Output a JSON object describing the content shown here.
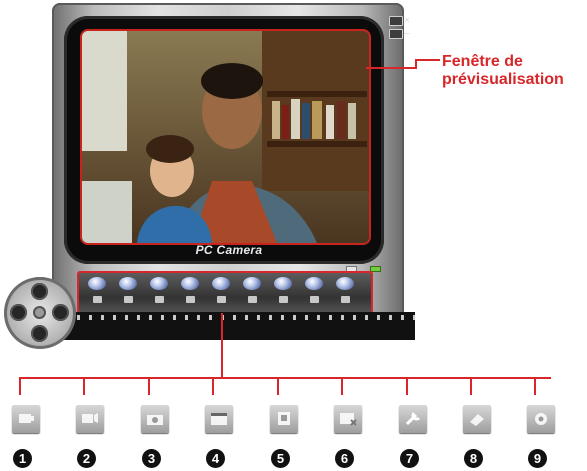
{
  "app": {
    "brand": "PC Camera"
  },
  "window_controls": {
    "close_glyph": "×",
    "minimize_glyph": "–"
  },
  "callout": {
    "preview_label": "Fenêtre de prévisualisation"
  },
  "toolbar": {
    "buttons": [
      {
        "icon": "video-capture-icon"
      },
      {
        "icon": "video-edit-icon"
      },
      {
        "icon": "snapshot-camera-icon"
      },
      {
        "icon": "clapper-icon"
      },
      {
        "icon": "frame-edit-icon"
      },
      {
        "icon": "screen-delete-icon"
      },
      {
        "icon": "wrench-icon"
      },
      {
        "icon": "eraser-icon"
      },
      {
        "icon": "settings-gear-icon"
      }
    ]
  },
  "legend": {
    "numbers": [
      "1",
      "2",
      "3",
      "4",
      "5",
      "6",
      "7",
      "8",
      "9"
    ],
    "icons": [
      "video-capture-icon",
      "video-edit-icon",
      "snapshot-camera-icon",
      "clapper-icon",
      "frame-edit-icon",
      "screen-delete-icon",
      "wrench-icon",
      "eraser-icon",
      "settings-gear-icon"
    ]
  },
  "colors": {
    "accent": "#d8272a",
    "frame": "#c9c9c9",
    "toolbar_dome": "#8fa3d9"
  }
}
